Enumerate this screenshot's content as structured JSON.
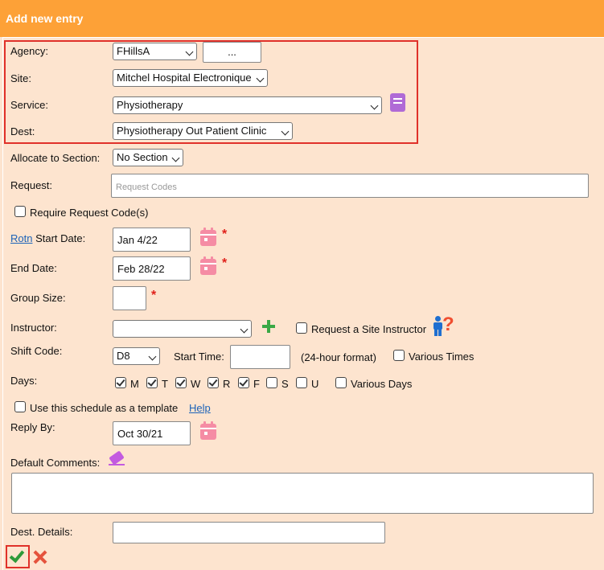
{
  "title": "Add new entry",
  "agency": {
    "label": "Agency:",
    "value": "FHillsA",
    "browse_label": "..."
  },
  "site": {
    "label": "Site:",
    "value": "Mitchel Hospital Electronique"
  },
  "service": {
    "label": "Service:",
    "value": "Physiotherapy"
  },
  "dest": {
    "label": "Dest:",
    "value": "Physiotherapy Out Patient Clinic"
  },
  "allocate": {
    "label": "Allocate to Section:",
    "value": "No Section"
  },
  "request": {
    "label": "Request:",
    "placeholder": "Request Codes"
  },
  "require_codes": {
    "label": "Require Request Code(s)",
    "checked": false
  },
  "start_date": {
    "link": "Rotn",
    "label": " Start Date:",
    "value": "Jan 4/22"
  },
  "end_date": {
    "label": "End Date:",
    "value": "Feb 28/22"
  },
  "group_size": {
    "label": "Group Size:",
    "value": ""
  },
  "instructor": {
    "label": "Instructor:",
    "value": "",
    "request_label": "Request a Site Instructor"
  },
  "shift": {
    "label": "Shift Code:",
    "value": "D8",
    "start_time_label": "Start Time:",
    "start_time_value": "",
    "format_note": "(24-hour format)",
    "various_times_label": "Various Times"
  },
  "days": {
    "label": "Days:",
    "items": [
      {
        "letter": "M",
        "checked": true
      },
      {
        "letter": "T",
        "checked": true
      },
      {
        "letter": "W",
        "checked": true
      },
      {
        "letter": "R",
        "checked": true
      },
      {
        "letter": "F",
        "checked": true
      },
      {
        "letter": "S",
        "checked": false
      },
      {
        "letter": "U",
        "checked": false
      }
    ],
    "various_days_label": "Various Days"
  },
  "template": {
    "label": "Use this schedule as a template",
    "help": "Help"
  },
  "reply_by": {
    "label": "Reply By:",
    "value": "Oct 30/21"
  },
  "comments": {
    "label": "Default Comments:"
  },
  "dest_details": {
    "label": "Dest. Details:"
  },
  "required_mark": "*",
  "colors": {
    "header": "#fda137",
    "background": "#fde4cf",
    "accent_red": "#e0312a",
    "ok_green": "#2f9a3a"
  }
}
